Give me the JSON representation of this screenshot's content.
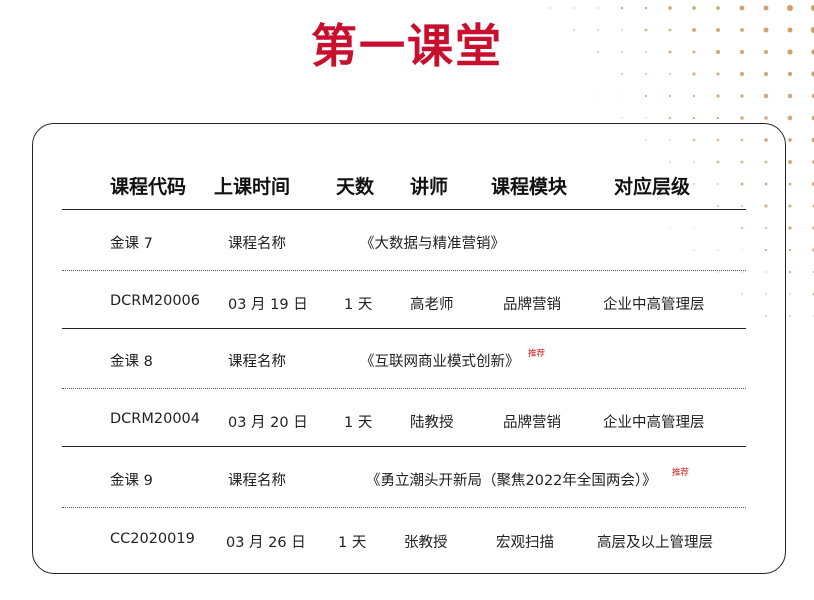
{
  "title": "第一课堂",
  "headers": [
    "课程代码",
    "上课时间",
    "天数",
    "讲师",
    "课程模块",
    "对应层级"
  ],
  "courses": [
    {
      "code": "金课  7",
      "name_label": "课程名称",
      "name": "《大数据与精准营销》",
      "badge": "",
      "detail": {
        "code": "DCRM20006",
        "date": "03 月 19 日",
        "days": "1 天",
        "teacher": "高老师",
        "module": "品牌营销",
        "level": "企业中高管理层"
      }
    },
    {
      "code": "金课  8",
      "name_label": "课程名称",
      "name": "《互联网商业模式创新》",
      "badge": "推荐",
      "detail": {
        "code": "DCRM20004",
        "date": "03 月 20 日",
        "days": "1 天",
        "teacher": "陆教授",
        "module": "品牌营销",
        "level": "企业中高管理层"
      }
    },
    {
      "code": "金课  9",
      "name_label": "课程名称",
      "name": "《勇立潮头开新局（聚焦2022年全国两会）》",
      "badge": "推荐",
      "detail": {
        "code": "CC2020019",
        "date": "03 月 26 日",
        "days": "1 天",
        "teacher": "张教授",
        "module": "宏观扫描",
        "level": "高层及以上管理层"
      }
    }
  ],
  "colors": {
    "title": "#c8102e",
    "dots": "#c9975a",
    "badge": "#d41a1a"
  }
}
